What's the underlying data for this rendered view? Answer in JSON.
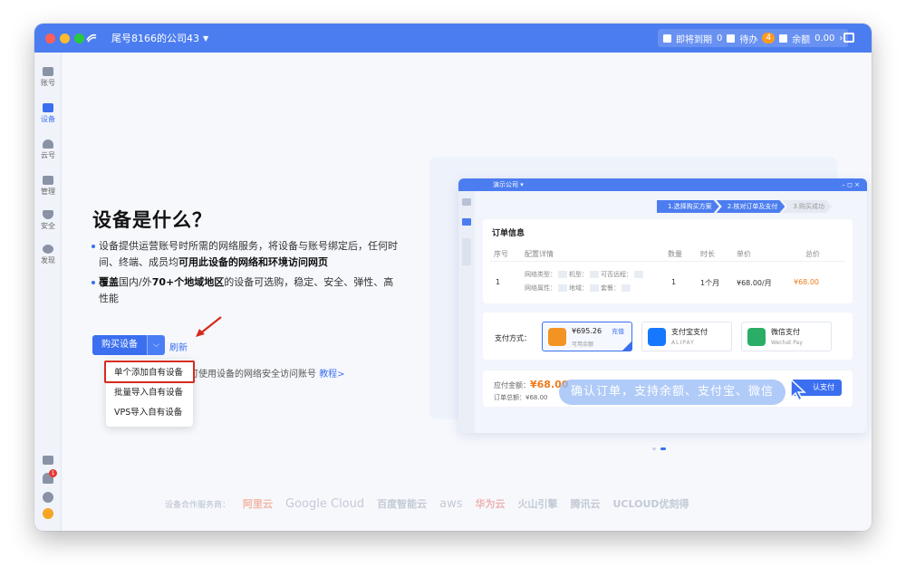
{
  "titlebar": {
    "company": "尾号8166的公司43",
    "expiring_label": "即将到期",
    "expiring_count": "0",
    "todo_label": "待办",
    "todo_count": "4",
    "balance_label": "余额",
    "balance_value": "0.00"
  },
  "sidebar": {
    "items": [
      {
        "label": "账号"
      },
      {
        "label": "设备"
      },
      {
        "label": "云号"
      },
      {
        "label": "管理"
      },
      {
        "label": "安全"
      },
      {
        "label": "发现"
      }
    ],
    "notification_badge": "1"
  },
  "main": {
    "title": "设备是什么？",
    "bullet1_part1": "设备提供运营账号时所需的网络服务，将设备与账号绑定后，任何时间、终端、成员均",
    "bullet1_bold": "可用此设备的网络和环境访问网页",
    "bullet2_bold1": "覆盖",
    "bullet2_part1": "国内/外",
    "bullet2_bold2": "70+个地域地区",
    "bullet2_part2": "的设备可选购，稳定、安全、弹性、高性能",
    "buy_button": "购买设备",
    "refresh": "刷新",
    "hint": "，即可使用设备的网络安全访问账号",
    "hint_link": "教程>",
    "dropdown": [
      "单个添加自有设备",
      "批量导入自有设备",
      "VPS导入自有设备"
    ]
  },
  "preview": {
    "company": "演示公司",
    "steps": [
      "1.选择购买方案",
      "2.核对订单及支付",
      "3.购买成功"
    ],
    "order_title": "订单信息",
    "headers": [
      "序号",
      "配置详情",
      "数量",
      "时长",
      "单价",
      "总价"
    ],
    "row": {
      "index": "1",
      "line1_a": "网络类型：",
      "line1_b": "机型：",
      "line1_c": "可否远程：",
      "line2_a": "网络属性：",
      "line2_b": "地域：",
      "line2_c": "套餐：",
      "qty": "1",
      "duration": "1个月",
      "unit_price": "¥68.00/月",
      "total": "¥68.00"
    },
    "pay_label": "支付方式：",
    "balance_amount": "¥695.26",
    "recharge": "充值",
    "balance_sub": "可用余额",
    "alipay": "支付宝支付",
    "alipay_en": "ALIPAY",
    "wechat": "微信支付",
    "wechat_en": "Wechat Pay",
    "due_label": "应付金额：",
    "due_value": "¥68.00",
    "order_total_label": "订单总额：",
    "order_total": "¥68.00",
    "pay_button": "认支付",
    "caption": "确认订单，支持余额、支付宝、微信"
  },
  "partners": {
    "label": "设备合作服务商：",
    "logos": [
      "阿里云",
      "Google Cloud",
      "百度智能云",
      "aws",
      "华为云",
      "火山引擎",
      "腾讯云",
      "UCLOUD优刻得"
    ]
  },
  "colors": {
    "brand": "#4c7df0",
    "primary": "#3b6ff0",
    "highlight": "#d52b1e",
    "accent_orange": "#f07b1d"
  }
}
